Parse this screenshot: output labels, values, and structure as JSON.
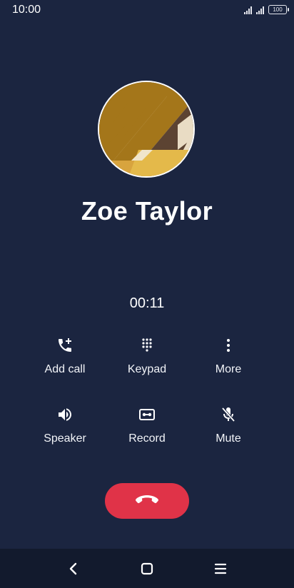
{
  "status_bar": {
    "time": "10:00",
    "battery": "100"
  },
  "caller": {
    "name": "Zoe Taylor",
    "duration": "00:11"
  },
  "actions": [
    {
      "label": "Add call",
      "icon": "add-call-icon"
    },
    {
      "label": "Keypad",
      "icon": "keypad-icon"
    },
    {
      "label": "More",
      "icon": "more-vertical-icon"
    },
    {
      "label": "Speaker",
      "icon": "speaker-icon"
    },
    {
      "label": "Record",
      "icon": "record-icon"
    },
    {
      "label": "Mute",
      "icon": "mic-off-icon"
    }
  ],
  "end_call": {
    "icon": "end-call-icon"
  },
  "colors": {
    "background": "#1b2540",
    "end_call": "#e03348",
    "nav_bar": "#121a2d"
  }
}
